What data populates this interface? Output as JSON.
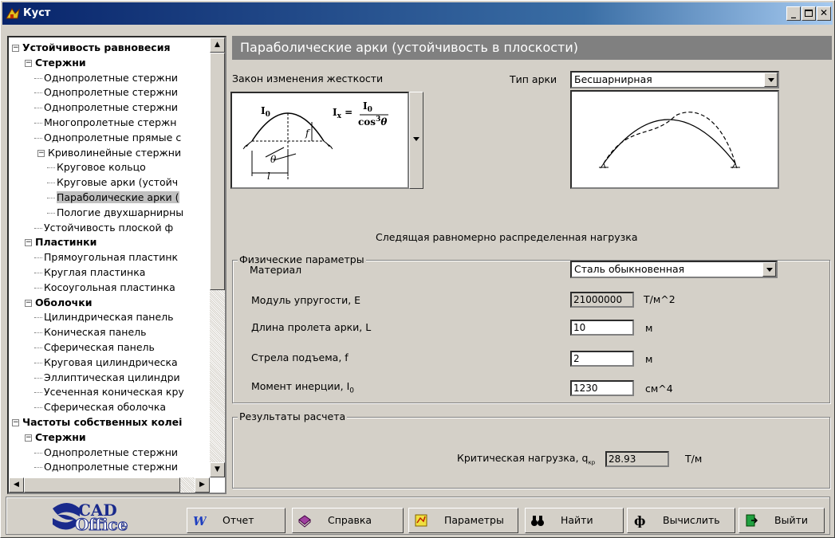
{
  "window": {
    "title": "Куст"
  },
  "tree": {
    "items": [
      {
        "label": "Устойчивость равновесия",
        "level": 0,
        "bold": true,
        "expander": "−"
      },
      {
        "label": "Стержни",
        "level": 1,
        "bold": true,
        "expander": "−"
      },
      {
        "label": "Однопролетные стержни",
        "level": 2
      },
      {
        "label": "Однопролетные стержни",
        "level": 2
      },
      {
        "label": "Однопролетные стержни",
        "level": 2
      },
      {
        "label": "Многопролетные стержн",
        "level": 2
      },
      {
        "label": "Однопролетные прямые с",
        "level": 2
      },
      {
        "label": "Криволинейные стержни",
        "level": 2,
        "expander": "−"
      },
      {
        "label": "Круговое кольцо",
        "level": 3
      },
      {
        "label": "Круговые арки (устойч",
        "level": 3
      },
      {
        "label": "Параболические арки (",
        "level": 3,
        "selected": true
      },
      {
        "label": "Пологие двухшарнирны",
        "level": 3
      },
      {
        "label": "Устойчивость плоской ф",
        "level": 2
      },
      {
        "label": "Пластинки",
        "level": 1,
        "bold": true,
        "expander": "−"
      },
      {
        "label": "Прямоугольная пластинк",
        "level": 2
      },
      {
        "label": "Круглая пластинка",
        "level": 2
      },
      {
        "label": "Косоугольная пластинка",
        "level": 2
      },
      {
        "label": "Оболочки",
        "level": 1,
        "bold": true,
        "expander": "−"
      },
      {
        "label": "Цилиндрическая панель",
        "level": 2
      },
      {
        "label": "Коническая панель",
        "level": 2
      },
      {
        "label": "Сферическая панель",
        "level": 2
      },
      {
        "label": "Круговая цилиндрическа",
        "level": 2
      },
      {
        "label": "Эллиптическая цилиндри",
        "level": 2
      },
      {
        "label": "Усеченная коническая кру",
        "level": 2
      },
      {
        "label": "Сферическая оболочка",
        "level": 2
      },
      {
        "label": "Частоты собственных колеі",
        "level": 0,
        "bold": true,
        "expander": "−"
      },
      {
        "label": "Стержни",
        "level": 1,
        "bold": true,
        "expander": "−"
      },
      {
        "label": "Однопролетные стержни",
        "level": 2
      },
      {
        "label": "Однопролетные стержни",
        "level": 2
      }
    ]
  },
  "main": {
    "header": "Параболические арки (устойчивость в плоскости)",
    "stiffness_label": "Закон изменения жесткости",
    "arch_type_label": "Тип арки",
    "arch_type_value": "Бесшарнирная",
    "formula": {
      "lhs": "I",
      "lhs_sub": "x",
      "num": "I",
      "num_sub": "0",
      "den": "cos",
      "den_pow": "3",
      "den_var": "θ",
      "i0": "I",
      "i0_sub": "0",
      "f": "f",
      "l": "l",
      "theta": "θ"
    },
    "load_text": "Следящая равномерно распределенная нагрузка",
    "physical": {
      "title": "Физические параметры",
      "material_label": "Материал",
      "material_value": "Сталь обыкновенная",
      "modulus_label": "Модуль упругости, E",
      "modulus_value": "21000000",
      "modulus_unit": "Т/м^2",
      "length_label": "Длина пролета арки, L",
      "length_value": "10",
      "length_unit": "м",
      "rise_label": "Стрела подъема, f",
      "rise_value": "2",
      "rise_unit": "м",
      "inertia_label": "Момент инерции, I",
      "inertia_sub": "0",
      "inertia_value": "1230",
      "inertia_unit": "см^4"
    },
    "results": {
      "title": "Результаты расчета",
      "critical_label": "Критическая нагрузка, q",
      "critical_sub": "кр",
      "critical_value": "28.93",
      "critical_unit": "Т/м"
    }
  },
  "logo": {
    "line1": "CAD",
    "line2": "Office"
  },
  "buttons": [
    {
      "label": "Отчет"
    },
    {
      "label": "Справка"
    },
    {
      "label": "Параметры"
    },
    {
      "label": "Найти"
    },
    {
      "label": "Вычислить"
    },
    {
      "label": "Выйти"
    }
  ]
}
